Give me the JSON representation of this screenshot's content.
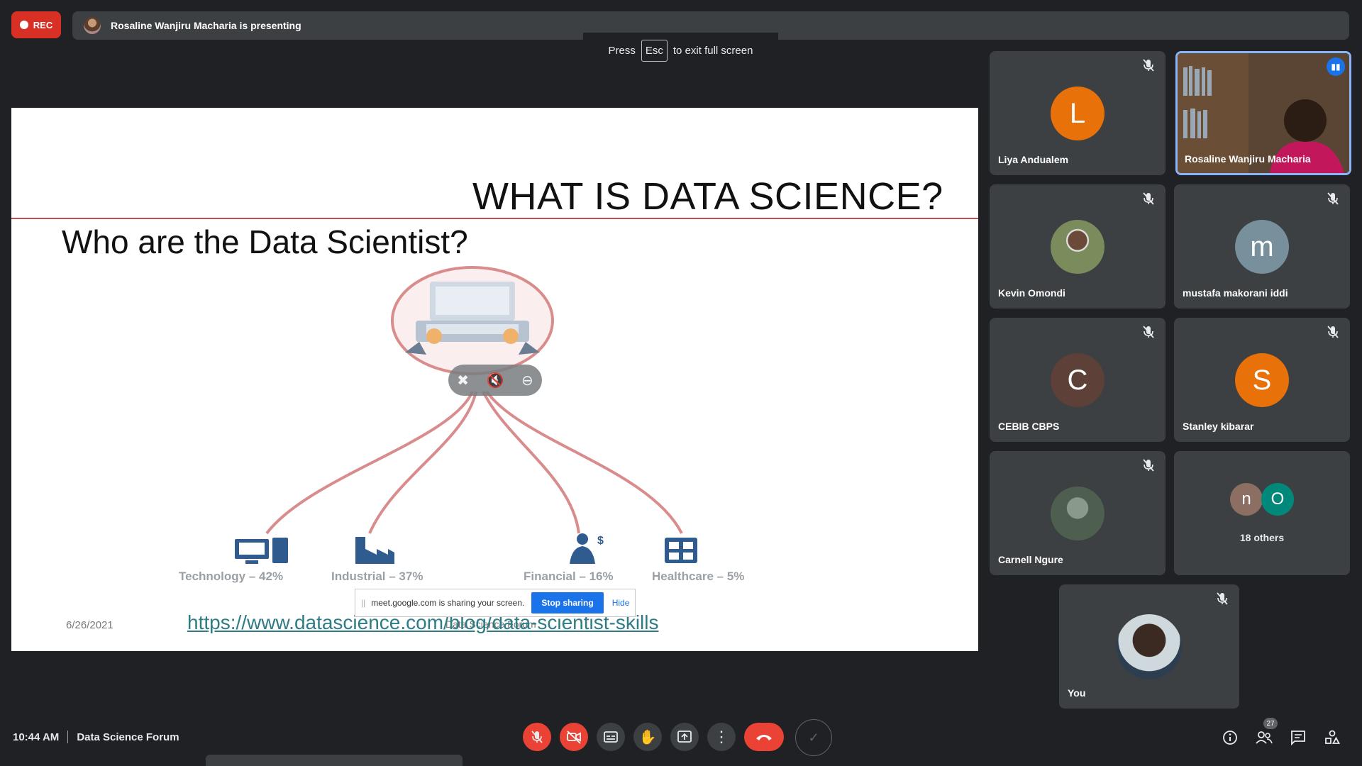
{
  "top_bar": {
    "rec_label": "REC",
    "presenting_text": "Rosaline Wanjiru Macharia is presenting",
    "fullscreen_hint": {
      "before": "Press",
      "key": "Esc",
      "after": "to exit full screen"
    }
  },
  "slide": {
    "title": "WHAT IS DATA SCIENCE?",
    "subtitle": "Who are the Data Scientist?",
    "categories": [
      {
        "label": "Technology – 42%",
        "icon": "computer-icon"
      },
      {
        "label": "Industrial – 37%",
        "icon": "factory-icon"
      },
      {
        "label": "Financial – 16%",
        "icon": "banker-icon"
      },
      {
        "label": "Healthcare – 5%",
        "icon": "hospital-icon"
      }
    ],
    "date": "6/26/2021",
    "url": "https://www.datascience.com/blog/data-scientist-skills",
    "footer": "Data Science Forum"
  },
  "share_banner": {
    "message": "meet.google.com is sharing your screen.",
    "stop_label": "Stop sharing",
    "hide_label": "Hide"
  },
  "participants": [
    {
      "name": "Liya Andualem",
      "initial": "L",
      "color": "#e8710a",
      "muted": true
    },
    {
      "name": "Rosaline Wanjiru Macharia",
      "speaking": true
    },
    {
      "name": "Kevin Omondi",
      "muted": true
    },
    {
      "name": "mustafa makorani iddi",
      "initial": "m",
      "color": "#78909c",
      "muted": true
    },
    {
      "name": "CEBIB CBPS",
      "initial": "C",
      "color": "#5d4037",
      "muted": true
    },
    {
      "name": "Stanley kibarar",
      "initial": "S",
      "color": "#e8710a",
      "muted": true
    },
    {
      "name": "Carnell Ngure",
      "muted": true
    },
    {
      "name": "You",
      "muted": true
    }
  ],
  "others": {
    "label": "18 others",
    "avatars": [
      {
        "initial": "n",
        "color": "#8d6e63"
      },
      {
        "initial": "O",
        "color": "#00897b"
      }
    ]
  },
  "bottom_bar": {
    "time": "10:44 AM",
    "meeting_name": "Data Science Forum",
    "people_count": "27"
  },
  "colors": {
    "accent": "#8ab4f8",
    "danger": "#ea4335",
    "background": "#202124",
    "tile": "#3c4043"
  }
}
